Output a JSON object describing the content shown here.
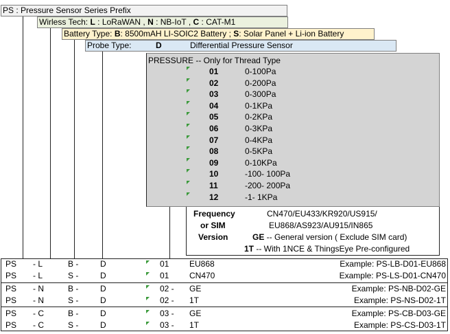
{
  "prefix": {
    "code": "PS",
    "text": " : Pressure Sensor Series Prefix"
  },
  "wireless": {
    "label": "Wirless Tech:  ",
    "opt1_code": "L",
    "opt1_text": " : LoRaWAN , ",
    "opt2_code": "N",
    "opt2_text": " : NB-IoT , ",
    "opt3_code": "C",
    "opt3_text": " : CAT-M1"
  },
  "battery": {
    "label": "Battery Type:  ",
    "opt1_code": "B",
    "opt1_text": ": 8500mAH LI-SOIC2 Battery ; ",
    "opt2_code": "S",
    "opt2_text": ": Solar Panel + Li-ion Battery"
  },
  "probe": {
    "label": "Probe Type:",
    "code": "D",
    "text": "Differential Pressure Sensor"
  },
  "pressure": {
    "title": "PRESSURE -- Only for Thread Type",
    "rows": [
      {
        "code": "01",
        "range": "0-100Pa"
      },
      {
        "code": "02",
        "range": "0-200Pa"
      },
      {
        "code": "03",
        "range": "0-300Pa"
      },
      {
        "code": "04",
        "range": "0-1KPa"
      },
      {
        "code": "05",
        "range": "0-2KPa"
      },
      {
        "code": "06",
        "range": "0-3KPa"
      },
      {
        "code": "07",
        "range": "0-4KPa"
      },
      {
        "code": "08",
        "range": "0-5KPa"
      },
      {
        "code": "09",
        "range": "0-10KPa"
      },
      {
        "code": "10",
        "range": "-100- 100Pa"
      },
      {
        "code": "11",
        "range": "-200- 200Pa"
      },
      {
        "code": "12",
        "range": "-1- 1KPa"
      }
    ]
  },
  "freq": {
    "label1": "Frequency",
    "label2": "or  SIM",
    "label3": "Version",
    "bands1": "CN470/EU433/KR920/US915/",
    "bands2": "EU868/AS923/AU915/IN865",
    "ge_code": "GE",
    "ge_text": " -- General version ( Exclude SIM card)",
    "t_code": "1T",
    "t_text": " -- With 1NCE & ThingsEye Pre-configured"
  },
  "examples": [
    {
      "c1": "PS",
      "c2": "-  L",
      "c3": "B  -",
      "c4": "D",
      "c5": "01",
      "c6": "EU868",
      "ex": "Example: PS-LB-D01-EU868"
    },
    {
      "c1": "PS",
      "c2": "-  L",
      "c3": "S  -",
      "c4": "D",
      "c5": "01",
      "c6": "CN470",
      "ex": "Example: PS-LS-D01-CN470"
    },
    {
      "c1": "PS",
      "c2": "-  N",
      "c3": "B  -",
      "c4": "D",
      "c5": "02  -",
      "c6": "GE",
      "ex": "Example: PS-NB-D02-GE"
    },
    {
      "c1": "PS",
      "c2": "-  N",
      "c3": "S  -",
      "c4": "D",
      "c5": "02  -",
      "c6": "1T",
      "ex": "Example: PS-NS-D02-1T"
    },
    {
      "c1": "PS",
      "c2": "-  C",
      "c3": "B  -",
      "c4": "D",
      "c5": "03  -",
      "c6": "GE",
      "ex": "Example: PS-CB-D03-GE"
    },
    {
      "c1": "PS",
      "c2": "-  C",
      "c3": "S  -",
      "c4": "D",
      "c5": "03  -",
      "c6": "1T",
      "ex": "Example: PS-CS-D03-1T"
    }
  ],
  "colors": {
    "prefix_bg": "#f2f2f2",
    "wireless_bg": "#ebf1de",
    "battery_bg": "#fff2cc",
    "probe_bg": "#dae8f4",
    "pressure_bg": "#d4d4d4",
    "marker": "#3a9a3a"
  }
}
